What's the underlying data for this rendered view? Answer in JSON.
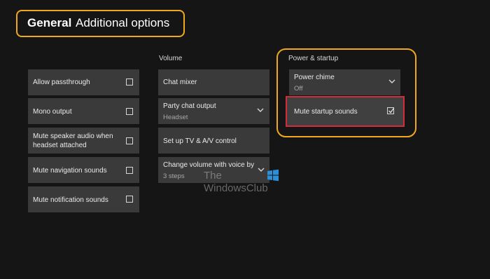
{
  "header": {
    "title": "General",
    "subtitle": "Additional options"
  },
  "left_column": {
    "items": [
      {
        "label": "Allow passthrough",
        "checked": false
      },
      {
        "label": "Mono output",
        "checked": false
      },
      {
        "label": "Mute speaker audio when headset attached",
        "checked": false
      },
      {
        "label": "Mute navigation sounds",
        "checked": false
      },
      {
        "label": "Mute notification sounds",
        "checked": false
      }
    ]
  },
  "volume": {
    "title": "Volume",
    "items": [
      {
        "label": "Chat mixer"
      },
      {
        "label": "Party chat output",
        "value": "Headset"
      },
      {
        "label": "Set up TV & A/V control"
      },
      {
        "label": "Change volume with voice by",
        "value": "3 steps"
      }
    ]
  },
  "power": {
    "title": "Power & startup",
    "power_chime": {
      "label": "Power chime",
      "value": "Off"
    },
    "mute_startup": {
      "label": "Mute startup sounds",
      "checked": true
    }
  },
  "watermark": {
    "line1": "The",
    "line2": "WindowsClub"
  },
  "colors": {
    "highlight": "#f0a81c",
    "selected": "#d22d3c",
    "tile": "#3a3a3a",
    "background": "#151515"
  }
}
